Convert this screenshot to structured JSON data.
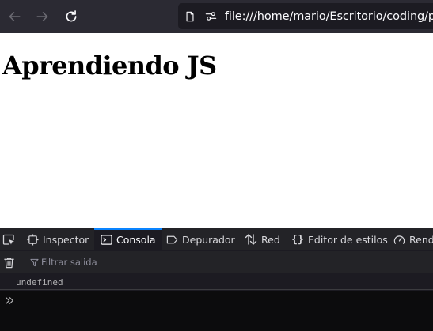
{
  "browser": {
    "url": "file:///home/mario/Escritorio/coding/pru",
    "icons": {
      "back": "arrow-left-icon",
      "forward": "arrow-right-icon",
      "reload": "reload-icon",
      "page": "page-icon",
      "permissions": "permissions-icon"
    }
  },
  "page": {
    "heading": "Aprendiendo JS"
  },
  "devtools": {
    "tabs": [
      {
        "label": "Inspector",
        "icon": "inspector-icon"
      },
      {
        "label": "Consola",
        "icon": "console-icon",
        "active": true
      },
      {
        "label": "Depurador",
        "icon": "debugger-icon"
      },
      {
        "label": "Red",
        "icon": "network-icon"
      },
      {
        "label": "Editor de estilos",
        "icon": "style-editor-icon"
      },
      {
        "label": "Rend",
        "icon": "performance-icon"
      }
    ],
    "filter_placeholder": "Filtrar salida",
    "console_output": [
      "undefined"
    ],
    "colors": {
      "accent": "#0a84ff",
      "toolbar_bg": "#2b2a33",
      "panel_bg": "#1c1b22"
    }
  }
}
